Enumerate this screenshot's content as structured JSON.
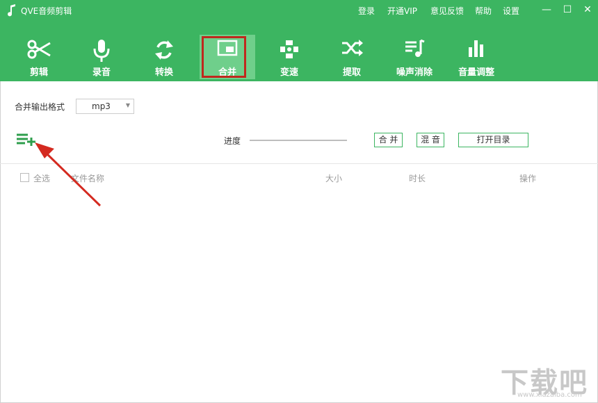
{
  "app": {
    "title": "QVE音频剪辑"
  },
  "top_links": [
    "登录",
    "开通VIP",
    "意见反馈",
    "帮助",
    "设置"
  ],
  "window_controls": {
    "minimize": "—",
    "maximize": "☐",
    "close": "✕"
  },
  "toolbar": {
    "items": [
      {
        "label": "剪辑",
        "icon": "scissors-icon"
      },
      {
        "label": "录音",
        "icon": "microphone-icon"
      },
      {
        "label": "转换",
        "icon": "refresh-icon"
      },
      {
        "label": "合并",
        "icon": "merge-icon",
        "active": true
      },
      {
        "label": "变速",
        "icon": "speed-icon"
      },
      {
        "label": "提取",
        "icon": "shuffle-icon"
      },
      {
        "label": "噪声消除",
        "icon": "noise-icon"
      },
      {
        "label": "音量调整",
        "icon": "volume-bars-icon"
      }
    ]
  },
  "format": {
    "label": "合并输出格式",
    "value": "mp3"
  },
  "actions": {
    "progress_label": "进度",
    "merge": "合 并",
    "mix": "混 音",
    "open_dir": "打开目录"
  },
  "table": {
    "select_all": "全选",
    "columns": [
      "文件名称",
      "大小",
      "时长",
      "操作"
    ]
  },
  "colors": {
    "brand": "#3cb561",
    "highlight": "#c0281d"
  },
  "watermark": {
    "main": "下载吧",
    "sub": "www.xiazaiba.com"
  }
}
